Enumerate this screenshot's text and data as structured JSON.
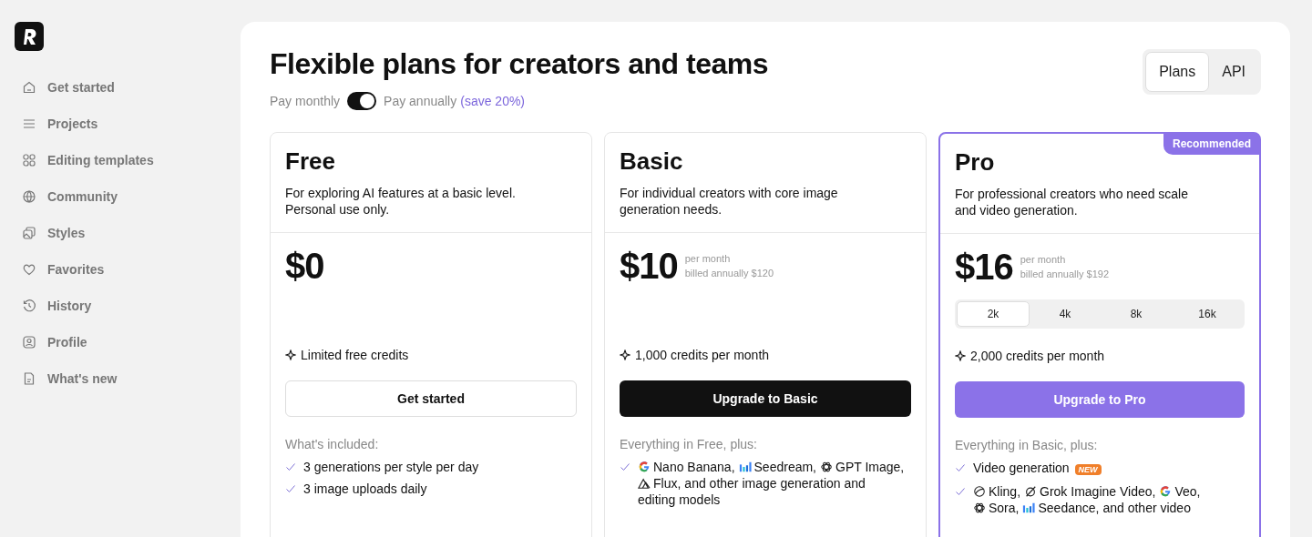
{
  "sidebar": {
    "items": [
      {
        "label": "Get started"
      },
      {
        "label": "Projects"
      },
      {
        "label": "Editing templates"
      },
      {
        "label": "Community"
      },
      {
        "label": "Styles"
      },
      {
        "label": "Favorites"
      },
      {
        "label": "History"
      },
      {
        "label": "Profile"
      },
      {
        "label": "What's new"
      }
    ]
  },
  "title": "Flexible plans for creators and teams",
  "view_tabs": [
    {
      "label": "Plans",
      "selected": true
    },
    {
      "label": "API",
      "selected": false
    }
  ],
  "billing": {
    "monthly_label": "Pay monthly",
    "annual_label": "Pay annually",
    "save": "(save 20%)",
    "annual": true
  },
  "plans": [
    {
      "name": "Free",
      "recommended": false,
      "description": "For exploring AI features at a basic level. Personal use only.",
      "price": "$0",
      "credits": "Limited free credits",
      "button": {
        "label": "Get started",
        "kind": "outline"
      },
      "features_title": "What's included:",
      "features": [
        [
          {
            "kind": "plain",
            "text": "3 generations per style per day"
          }
        ],
        [
          {
            "kind": "plain",
            "text": "3 image uploads daily"
          }
        ]
      ]
    },
    {
      "name": "Basic",
      "recommended": false,
      "description": "For individual creators with core image generation needs.",
      "price": "$10",
      "per": "per month",
      "billed": "billed annually $120",
      "credits": "1,000 credits per month",
      "button": {
        "label": "Upgrade to Basic",
        "kind": "dark"
      },
      "features_title": "Everything in Free, plus:",
      "features": [
        [
          {
            "kind": "g-logo",
            "text": "Nano Banana,"
          },
          {
            "kind": "bars-logo",
            "text": "Seedream,"
          },
          {
            "kind": "knot-logo",
            "text": "GPT Image,"
          },
          {
            "kind": "peaks-logo",
            "text": "Flux,"
          },
          {
            "kind": "plain",
            "text": "and other image generation and"
          },
          {
            "kind": "plain",
            "text": "editing models"
          }
        ]
      ]
    },
    {
      "name": "Pro",
      "recommended": true,
      "badge": "Recommended",
      "description": "For professional creators who need scale and video generation.",
      "price": "$16",
      "per": "per month",
      "billed": "billed annually $192",
      "resolutions": [
        {
          "label": "2k",
          "selected": true
        },
        {
          "label": "4k",
          "selected": false
        },
        {
          "label": "8k",
          "selected": false
        },
        {
          "label": "16k",
          "selected": false
        }
      ],
      "credits": "2,000 credits per month",
      "button": {
        "label": "Upgrade to Pro",
        "kind": "accent"
      },
      "features_title": "Everything in Basic, plus:",
      "features": [
        [
          {
            "kind": "plain",
            "text": "Video generation"
          },
          {
            "kind": "new-badge",
            "text": "NEW"
          }
        ],
        [
          {
            "kind": "ring-logo",
            "text": "Kling,"
          },
          {
            "kind": "slash-logo",
            "text": "Grok Imagine Video,"
          },
          {
            "kind": "g-logo",
            "text": "Veo,"
          },
          {
            "kind": "knot-logo",
            "text": "Sora,"
          },
          {
            "kind": "bars-logo",
            "text": "Seedance,"
          },
          {
            "kind": "plain",
            "text": "and other video"
          }
        ]
      ]
    }
  ]
}
